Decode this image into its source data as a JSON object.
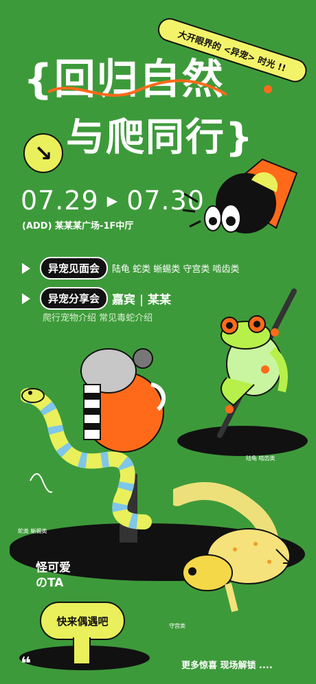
{
  "header": {
    "tag": "大开眼界的 <异宠> 时光 !!",
    "title_line1": "回归自然",
    "title_line2": "与爬同行"
  },
  "event": {
    "date_start": "07.29",
    "date_end": "07.30",
    "address": "(ADD)  某某某广场-1F中厅"
  },
  "program": [
    {
      "name": "异宠见面会",
      "detail": "陆龟  蛇类  蜥蜴类  守宫类  啮齿类"
    },
    {
      "name": "异宠分享会",
      "detail": "嘉宾 | 某某",
      "sub": "爬行宠物介绍  常见毒蛇介绍"
    }
  ],
  "labels": {
    "frog_label": "陆龟  啮齿类",
    "snake_label": "蛇类  蜥蜴类",
    "gecko_label": "守宫类",
    "cute_line1": "怪可爱",
    "cute_line2": "のTA",
    "sign_text": "快来偶遇吧"
  },
  "footer": {
    "text": "更多惊喜  现场解锁 ....",
    "quote": "❝"
  },
  "colors": {
    "background": "#3d9a3a",
    "accent_yellow": "#e9f05b",
    "accent_orange": "#ff6a1a"
  }
}
